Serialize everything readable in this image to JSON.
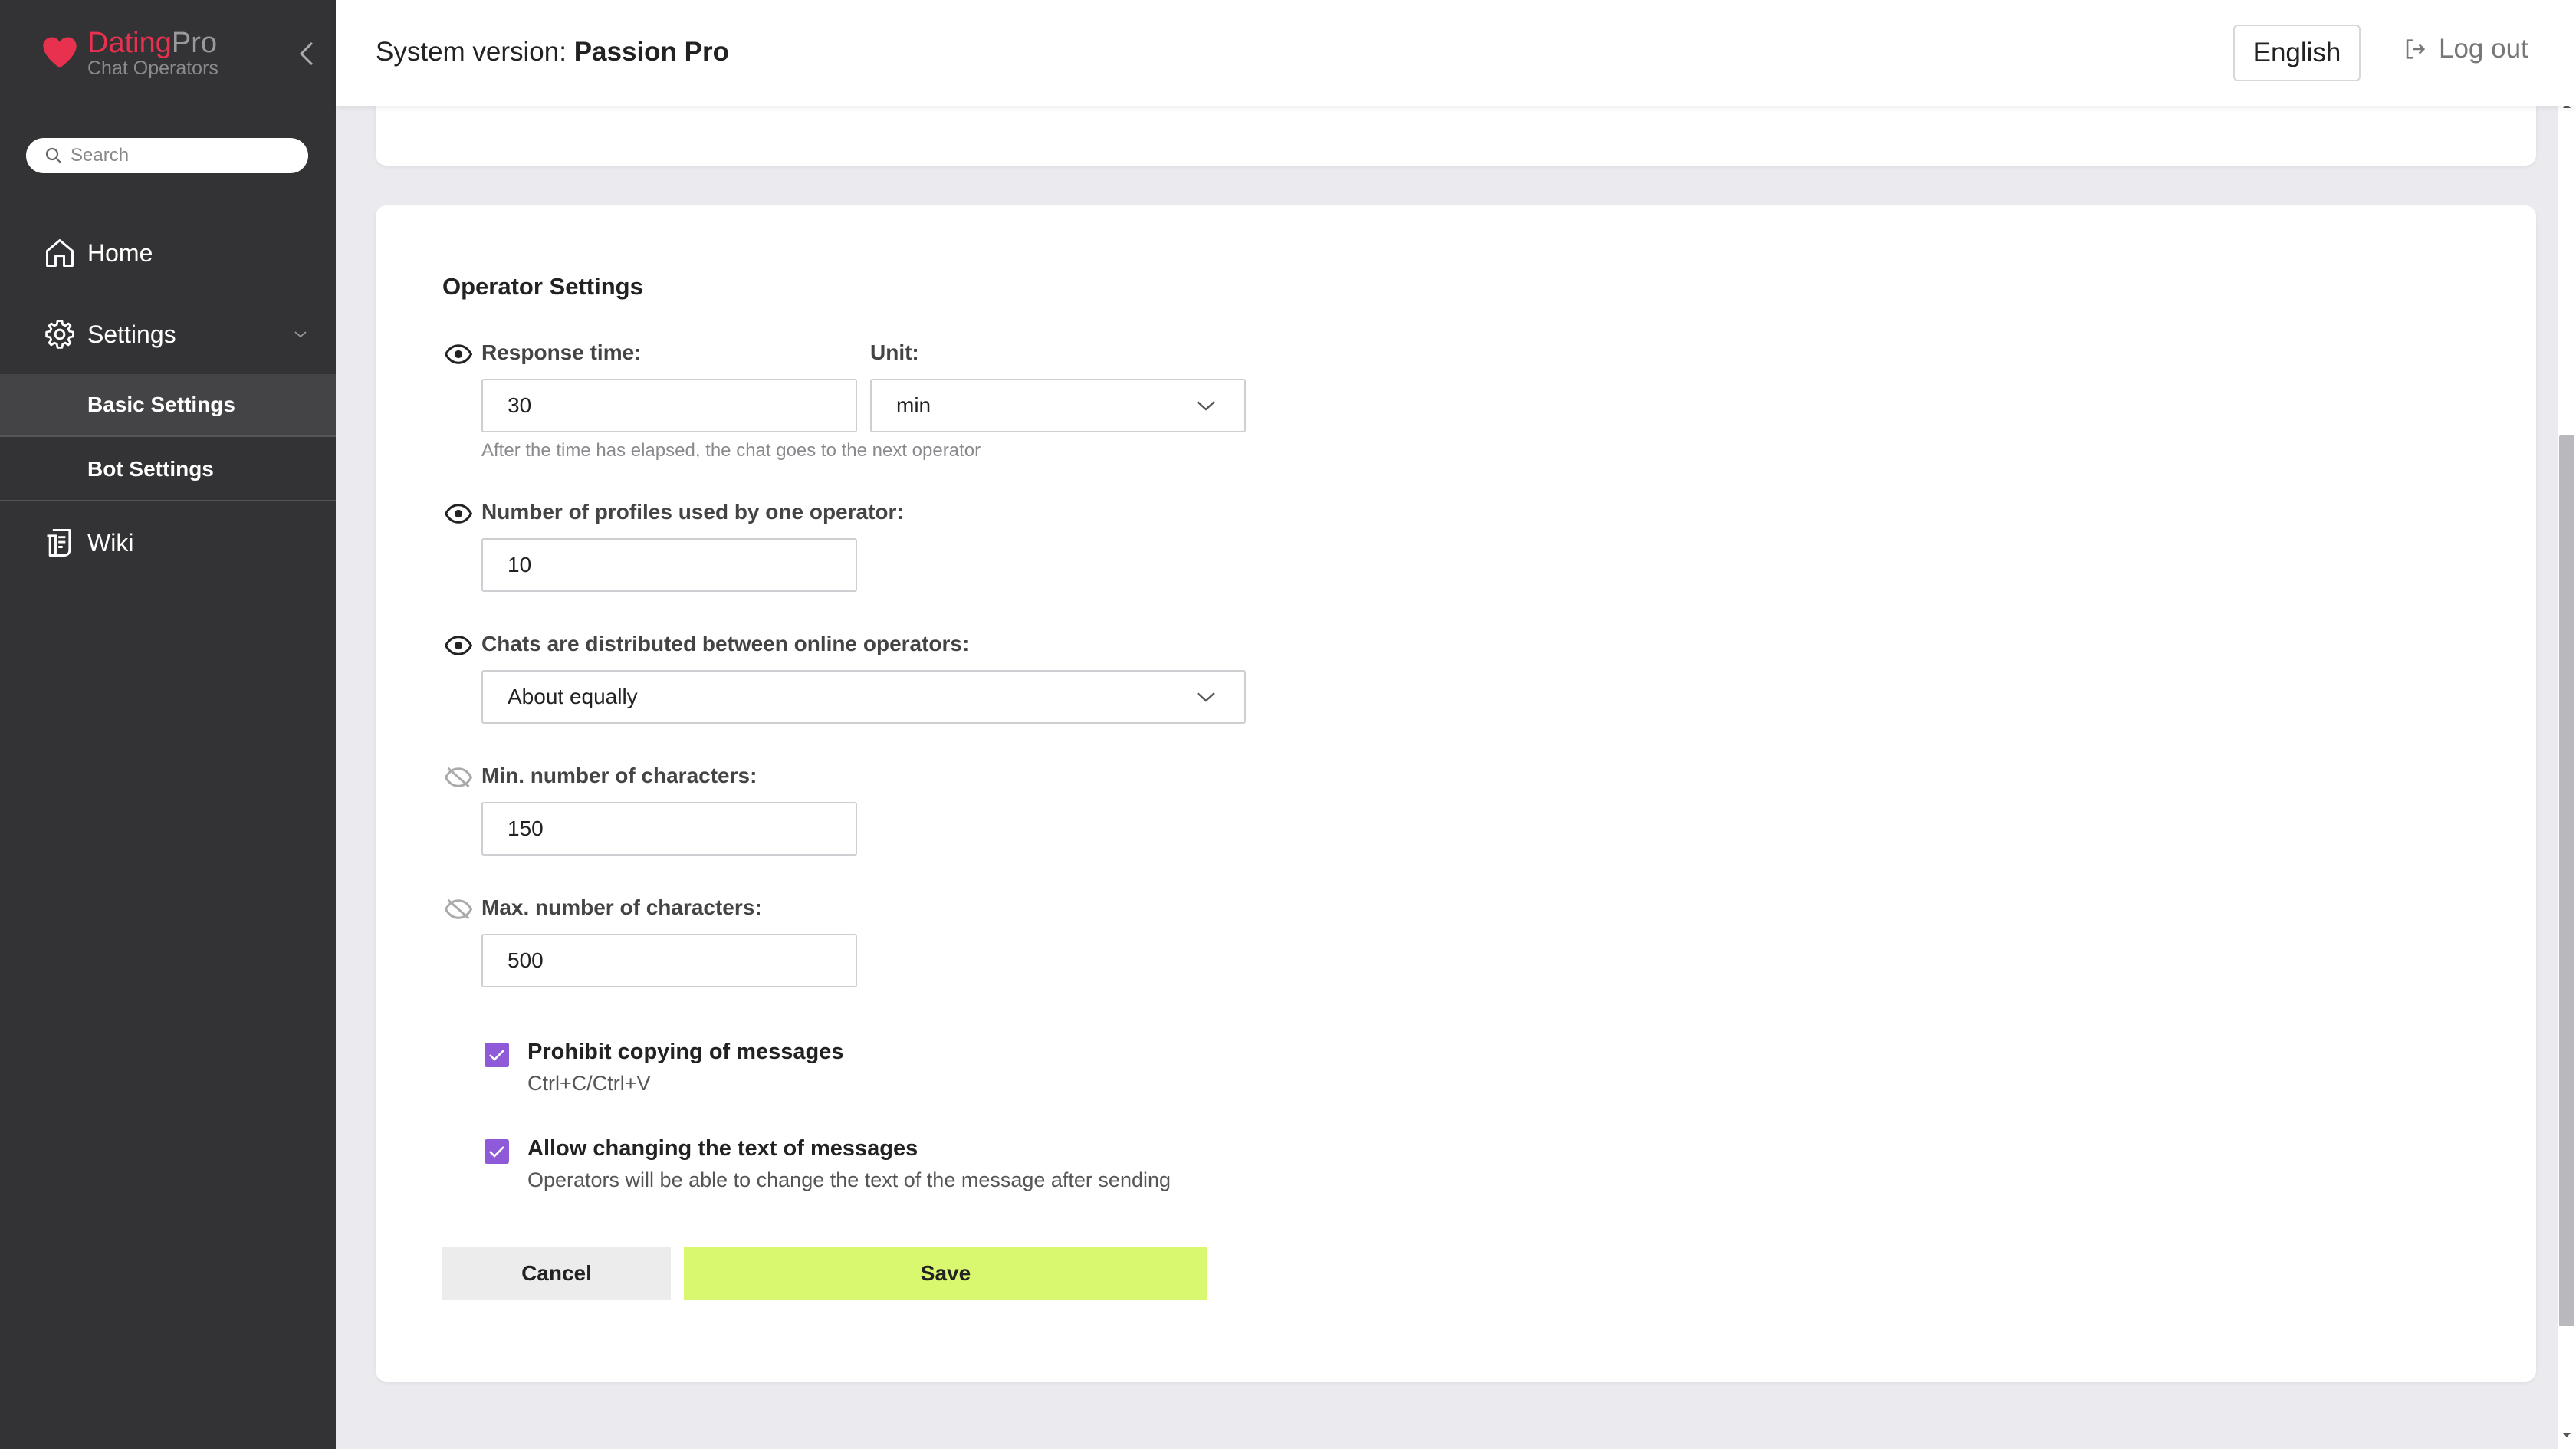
{
  "brand": {
    "name_part1": "Dating",
    "name_part2": "Pro",
    "subtitle": "Chat Operators",
    "accent_color": "#e8314f"
  },
  "sidebar": {
    "search_placeholder": "Search",
    "items": [
      {
        "label": "Home",
        "icon": "home-icon"
      },
      {
        "label": "Settings",
        "icon": "gear-icon",
        "expanded": true,
        "children": [
          {
            "label": "Basic Settings",
            "active": true
          },
          {
            "label": "Bot Settings",
            "active": false
          }
        ]
      },
      {
        "label": "Wiki",
        "icon": "wiki-icon"
      }
    ]
  },
  "header": {
    "system_version_label": "System version:",
    "system_version_value": "Passion Pro",
    "language": "English",
    "logout": "Log out"
  },
  "operator_settings": {
    "title": "Operator Settings",
    "response_time": {
      "label": "Response time:",
      "value": "30",
      "hint": "After the time has elapsed, the chat goes to the next operator",
      "visible": true
    },
    "unit": {
      "label": "Unit:",
      "value": "min"
    },
    "profiles_per_operator": {
      "label": "Number of profiles used by one operator:",
      "value": "10",
      "visible": true
    },
    "chat_distribution": {
      "label": "Chats are distributed between online operators:",
      "value": "About equally",
      "visible": true
    },
    "min_chars": {
      "label": "Min. number of characters:",
      "value": "150",
      "visible": false
    },
    "max_chars": {
      "label": "Max. number of characters:",
      "value": "500",
      "visible": false
    },
    "prohibit_copy": {
      "title": "Prohibit copying of messages",
      "subtitle": "Ctrl+C/Ctrl+V",
      "checked": true
    },
    "allow_edit": {
      "title": "Allow changing the text of messages",
      "subtitle": "Operators will be able to change the text of the message after sending",
      "checked": true
    },
    "cancel_label": "Cancel",
    "save_label": "Save",
    "checkbox_color": "#8e5ad8",
    "save_color": "#d9f76f"
  }
}
